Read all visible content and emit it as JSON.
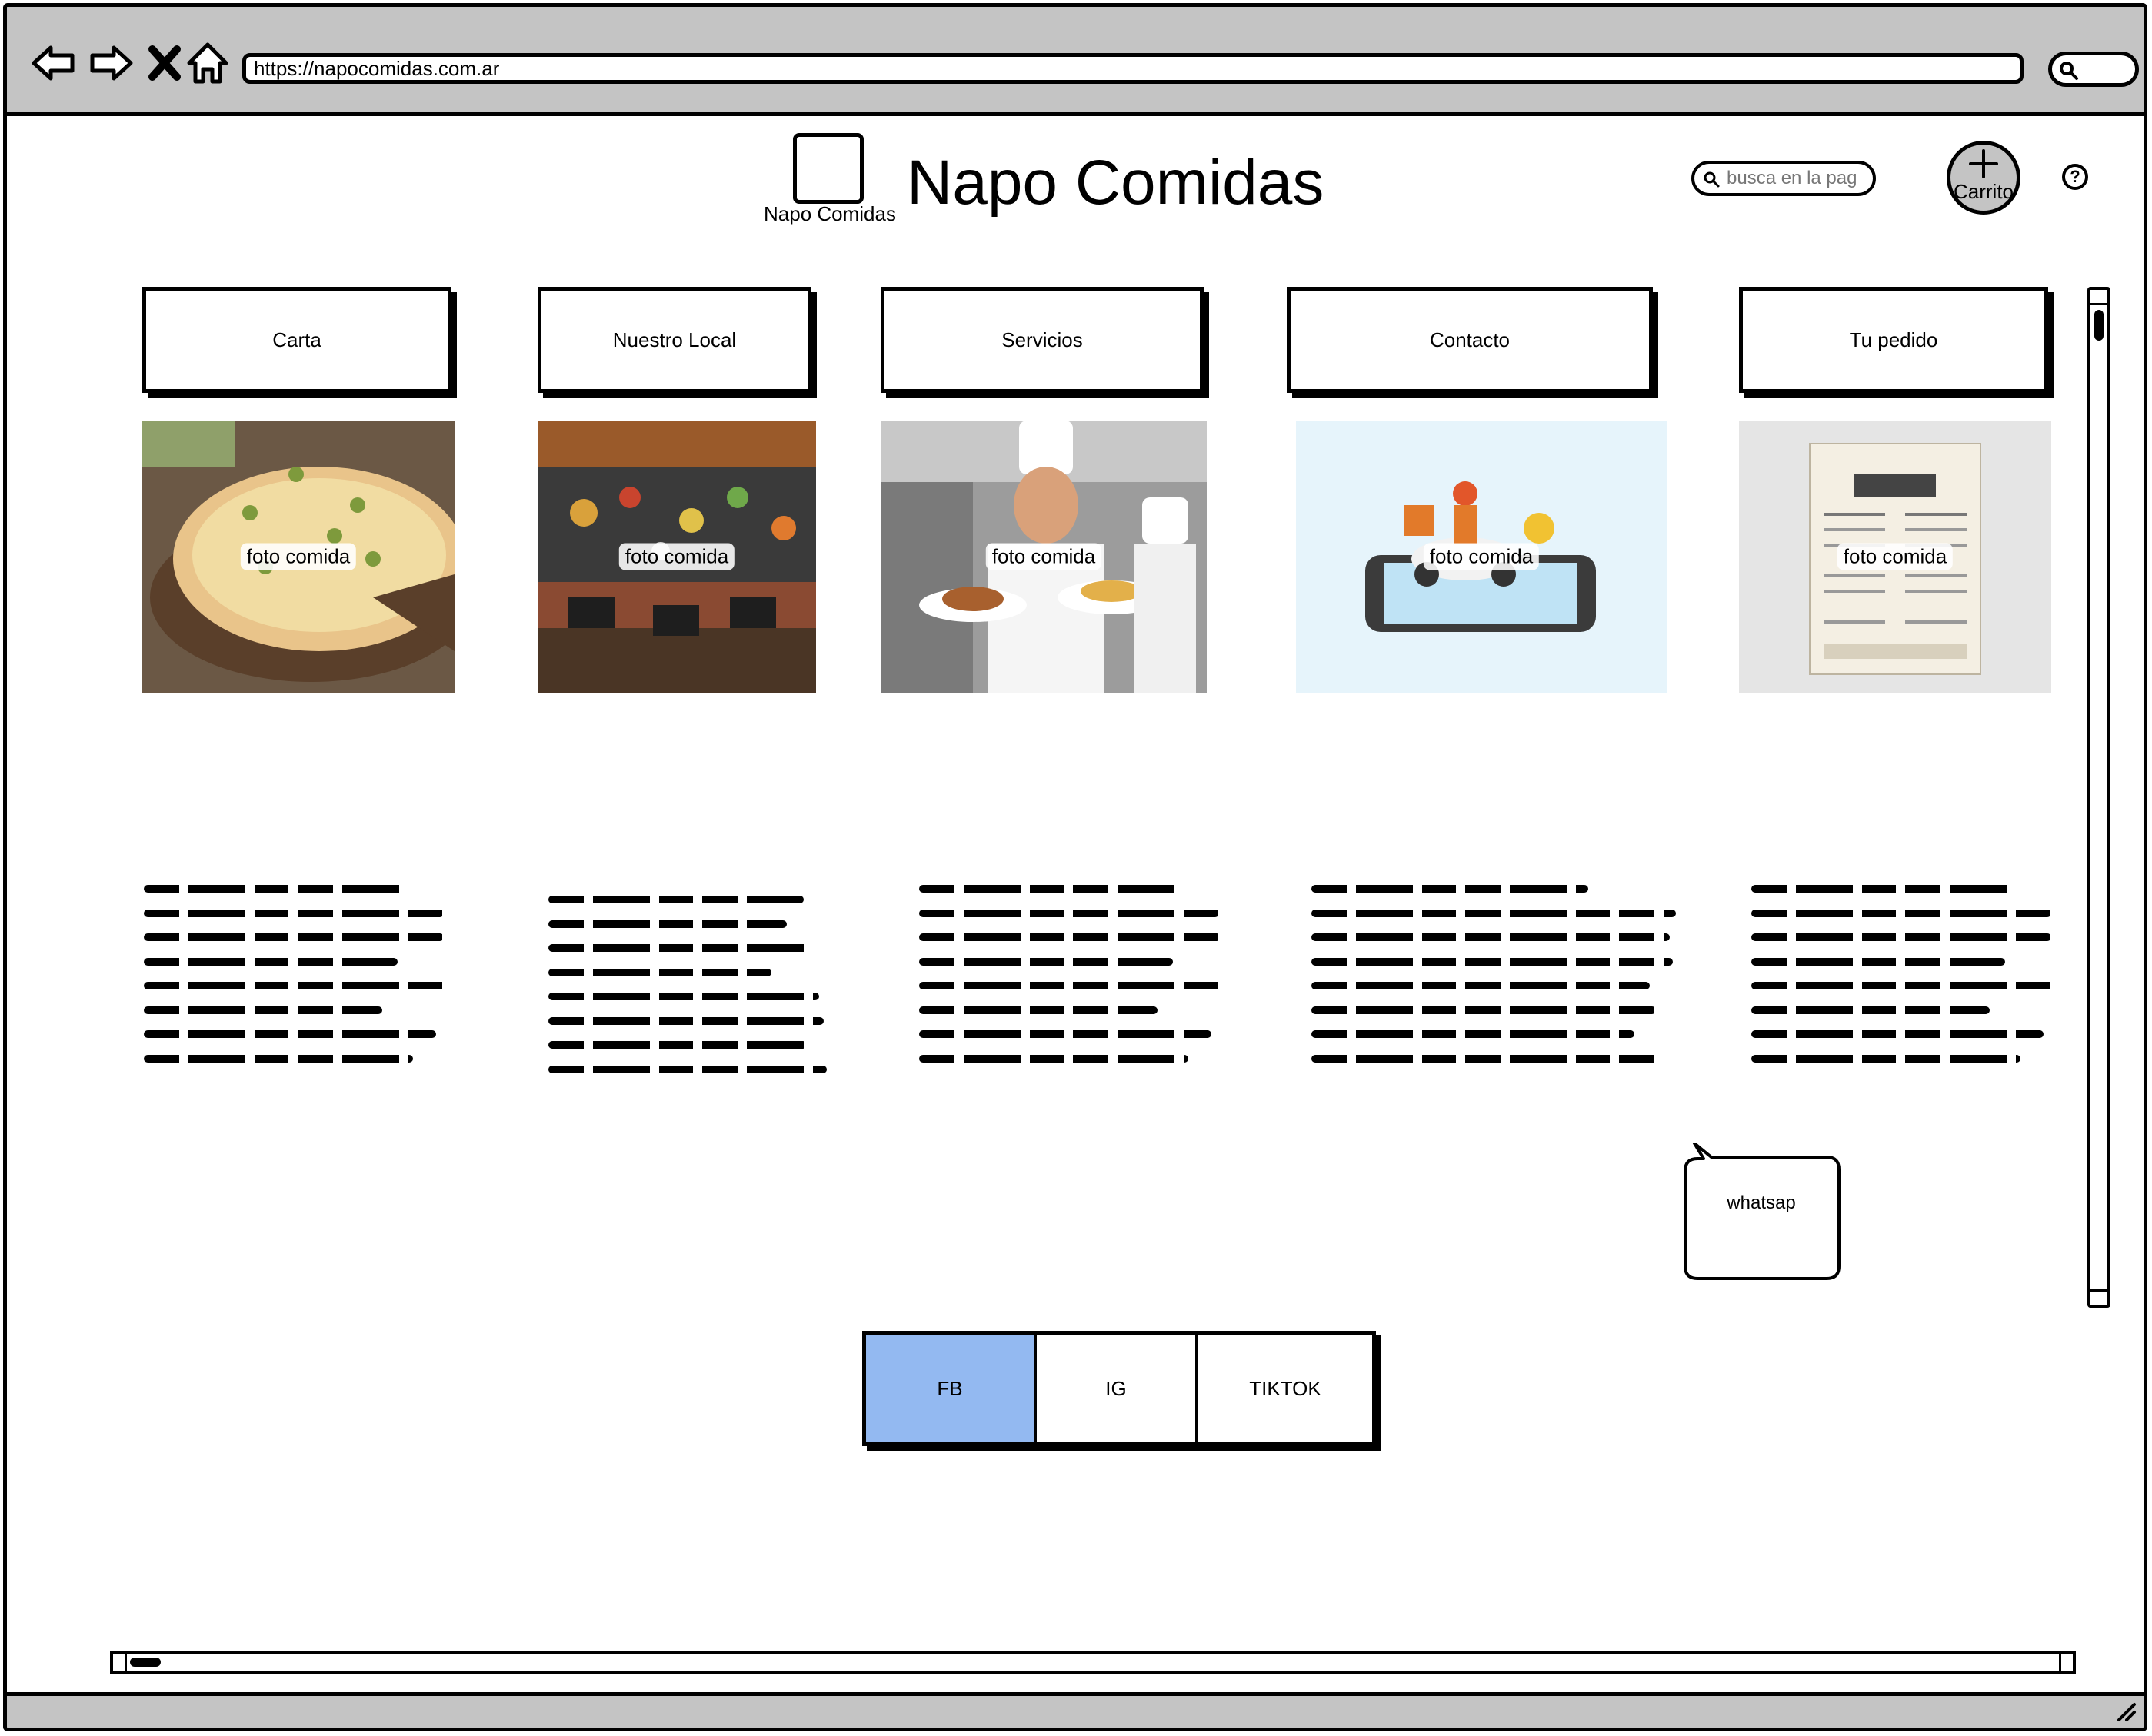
{
  "browser": {
    "url": "https://napocomidas.com.ar",
    "icons": [
      "back-icon",
      "forward-icon",
      "stop-icon",
      "home-icon",
      "search-icon"
    ]
  },
  "header": {
    "logo_label": "Napo Comidas",
    "title": "Napo Comidas",
    "search_placeholder": "busca en la pag",
    "cart_label": "Carrito",
    "help_label": "?"
  },
  "nav": [
    {
      "label": "Carta"
    },
    {
      "label": "Nuestro Local"
    },
    {
      "label": "Servicios"
    },
    {
      "label": "Contacto"
    },
    {
      "label": "Tu pedido"
    }
  ],
  "photos": [
    {
      "label": "foto comida"
    },
    {
      "label": "foto comida"
    },
    {
      "label": "foto comida"
    },
    {
      "label": "foto comida"
    },
    {
      "label": "foto comida"
    }
  ],
  "whatsapp": {
    "label": "whatsap"
  },
  "social": [
    {
      "label": "FB",
      "active": true
    },
    {
      "label": "IG",
      "active": false
    },
    {
      "label": "TIKTOK",
      "active": false
    }
  ],
  "colors": {
    "chrome": "#c4c4c4",
    "active_tab": "#93b9f1",
    "border": "#000000"
  }
}
